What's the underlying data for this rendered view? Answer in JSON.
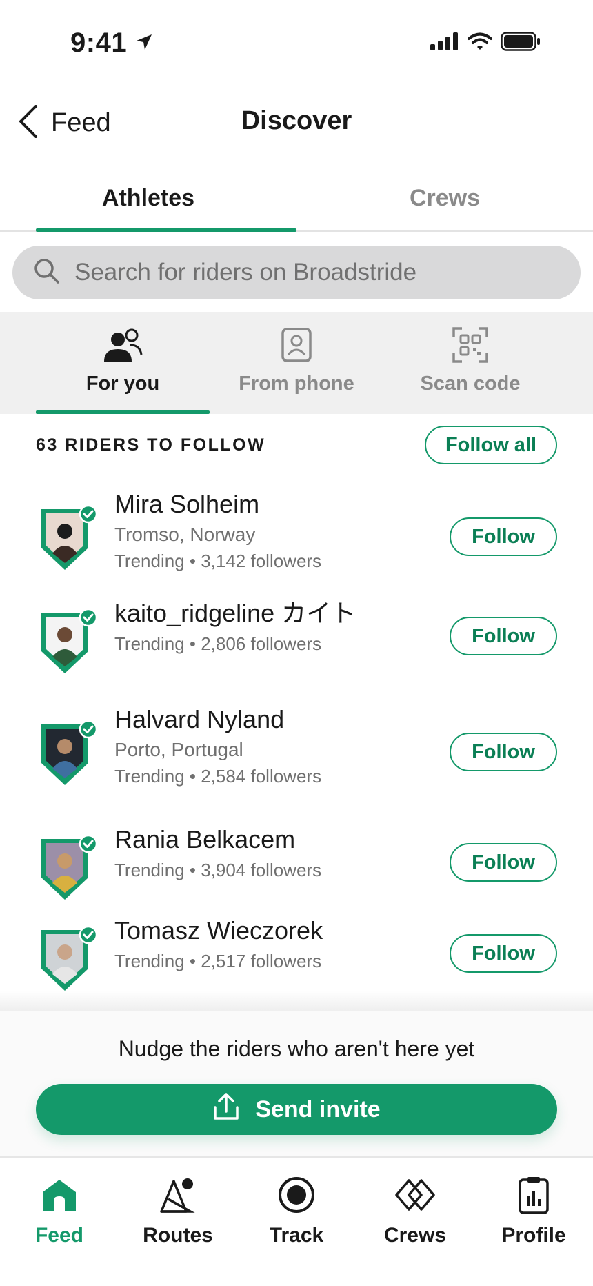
{
  "status_bar": {
    "time": "9:41"
  },
  "header": {
    "back_label": "Feed",
    "title": "Discover"
  },
  "tabs": [
    {
      "label": "Athletes",
      "active": true
    },
    {
      "label": "Crews",
      "active": false
    }
  ],
  "search": {
    "placeholder": "Search for riders on Broadstride"
  },
  "subtabs": [
    {
      "label": "For you",
      "icon": "people-icon",
      "active": true
    },
    {
      "label": "From phone",
      "icon": "contact-icon",
      "active": false
    },
    {
      "label": "Scan code",
      "icon": "qr-code-icon",
      "active": false
    }
  ],
  "list": {
    "count_label": "63 RIDERS TO FOLLOW",
    "follow_all_label": "Follow all",
    "riders": [
      {
        "name": "Mira Solheim",
        "location": "Tromso, Norway",
        "meta": "Trending • 3,142 followers",
        "follow_label": "Follow"
      },
      {
        "name": "kaito_ridgeline カイト",
        "location": "",
        "meta": "Trending • 2,806 followers",
        "follow_label": "Follow"
      },
      {
        "name": "Halvard Nyland",
        "location": "Porto, Portugal",
        "meta": "Trending • 2,584 followers",
        "follow_label": "Follow"
      },
      {
        "name": "Rania Belkacem",
        "location": "",
        "meta": "Trending • 3,904 followers",
        "follow_label": "Follow"
      },
      {
        "name": "Tomasz Wieczorek",
        "location": "",
        "meta": "Trending • 2,517 followers",
        "follow_label": "Follow"
      }
    ]
  },
  "invite": {
    "text": "Nudge the riders who aren't here yet",
    "button_label": "Send invite"
  },
  "bottom_nav": [
    {
      "label": "Feed",
      "icon": "home-icon",
      "active": true
    },
    {
      "label": "Routes",
      "icon": "routes-icon",
      "active": false
    },
    {
      "label": "Track",
      "icon": "record-icon",
      "active": false
    },
    {
      "label": "Crews",
      "icon": "crews-icon",
      "active": false
    },
    {
      "label": "Profile",
      "icon": "profile-icon",
      "active": false
    }
  ],
  "colors": {
    "accent": "#14996a",
    "text": "#1a1a1a",
    "muted": "#707070",
    "search_bg": "#d9d9da",
    "subtab_bg": "#f0f0f0"
  }
}
